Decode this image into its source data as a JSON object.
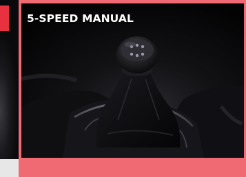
{
  "photo": {
    "title": "5-SPEED MANUAL",
    "alt": "gear-shift-knob-photo"
  },
  "colors": {
    "frame": "#f06a73",
    "badge": "#e8313e",
    "photo_bg": "#050506",
    "title_text": "#ffffff"
  }
}
